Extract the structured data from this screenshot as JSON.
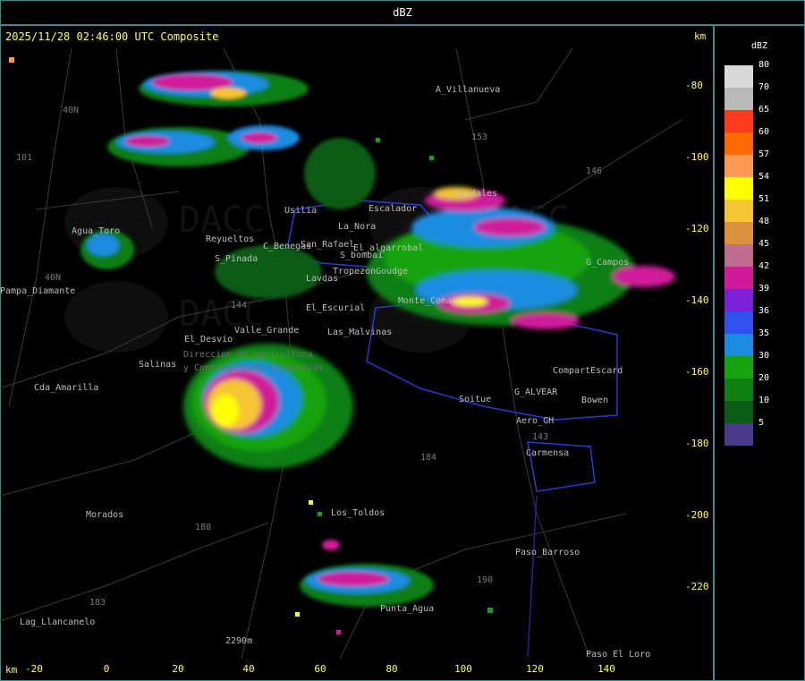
{
  "header": {
    "title": "dBZ"
  },
  "map": {
    "timestamp": "2025/11/28 02:46:00 UTC Composite",
    "km_label_top": "km",
    "km_label_bottom": "km",
    "y_ticks": [
      "-80",
      "-100",
      "-120",
      "-140",
      "-160",
      "-180",
      "-200",
      "-220"
    ],
    "x_ticks": [
      "-20",
      "0",
      "20",
      "40",
      "60",
      "80",
      "100",
      "120",
      "140"
    ],
    "places": [
      "A_Villanueva",
      "Usilia",
      "La_Nora",
      "Escalador",
      "Reyueltos",
      "C_Benegas",
      "San_Rafael",
      "El_algarrobal",
      "S_Pinada",
      "Lavdas",
      "Tropezon",
      "Goudge",
      "S_bombai",
      "Guadales",
      "El_Escurial",
      "Las_Malvinas",
      "Valle_Grande",
      "El_Desvio",
      "Salinas",
      "Cda_Amarilla",
      "Agua_Toro",
      "Pampa_Diamante",
      "Monte_Coman",
      "G_Campos",
      "CompartEscard",
      "G_ALVEAR",
      "Soitue",
      "Bowen",
      "Aero_GH",
      "Carmensa",
      "Los_Toldos",
      "Morados",
      "Paso_Barroso",
      "Punta_Agua",
      "Lag_Llancanelo",
      "2290m",
      "Paso_El_Loro",
      "Direccion de Agricultura",
      "y Contingencias Climaticas"
    ],
    "route_numbers": [
      "153",
      "146",
      "143",
      "101",
      "40N",
      "184",
      "180",
      "183",
      "190",
      "144",
      "40N"
    ],
    "watermark": "DACC"
  },
  "legend": {
    "unit": "dBZ",
    "levels": [
      {
        "label": "80",
        "color": "#d9d9d9"
      },
      {
        "label": "70",
        "color": "#b9b9b9"
      },
      {
        "label": "65",
        "color": "#ff3b1f"
      },
      {
        "label": "60",
        "color": "#ff6a00"
      },
      {
        "label": "57",
        "color": "#ff9a55"
      },
      {
        "label": "54",
        "color": "#ffff00"
      },
      {
        "label": "51",
        "color": "#f5c531"
      },
      {
        "label": "48",
        "color": "#d9913b"
      },
      {
        "label": "45",
        "color": "#c06b90"
      },
      {
        "label": "42",
        "color": "#d01a9a"
      },
      {
        "label": "39",
        "color": "#7c1fd6"
      },
      {
        "label": "36",
        "color": "#3050f0"
      },
      {
        "label": "35",
        "color": "#1a8ce0"
      },
      {
        "label": "30",
        "color": "#16a30e"
      },
      {
        "label": "20",
        "color": "#0f7f12"
      },
      {
        "label": "10",
        "color": "#0a5c14"
      },
      {
        "label": "5",
        "color": "#4a3a8c"
      }
    ]
  }
}
